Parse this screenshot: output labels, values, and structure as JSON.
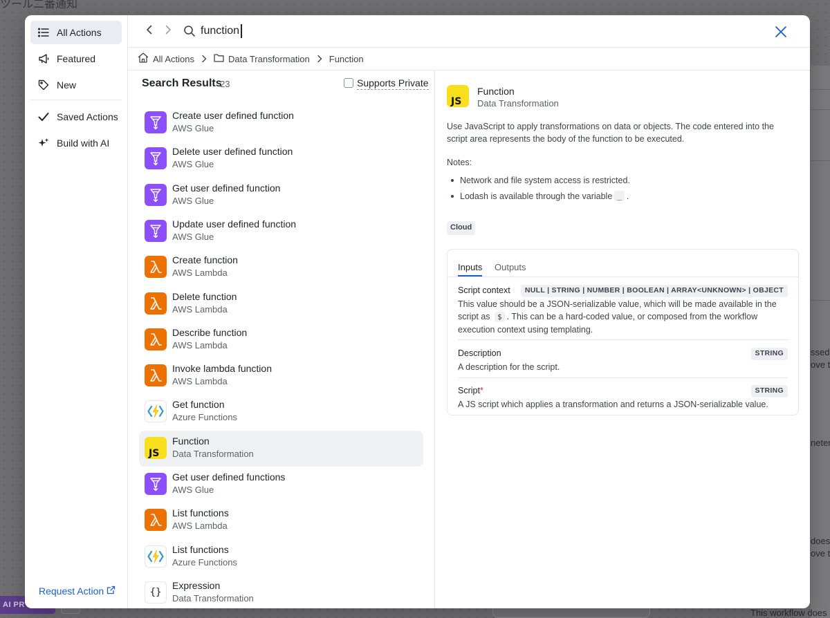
{
  "background": {
    "title_fragment": "ツール二番通知",
    "right_fragments": [
      "ssed",
      "ove to",
      "neters",
      "does",
      "ove t"
    ],
    "bottom_badge": "AI PR",
    "bottom_text": "This workflow does"
  },
  "sidebar": {
    "items": [
      {
        "label": "All Actions",
        "icon": "list-icon",
        "active": true
      },
      {
        "label": "Featured",
        "icon": "megaphone-icon",
        "active": false
      },
      {
        "label": "New",
        "icon": "tag-icon",
        "active": false
      },
      {
        "label": "Saved Actions",
        "icon": "check-icon",
        "active": false
      },
      {
        "label": "Build with AI",
        "icon": "sparkle-icon",
        "active": false
      }
    ],
    "request_action": "Request Action"
  },
  "search": {
    "value": "function"
  },
  "breadcrumb": {
    "items": [
      "All Actions",
      "Data Transformation",
      "Function"
    ]
  },
  "results": {
    "title": "Search Results",
    "count": "23",
    "supports_private_label": "Supports Private",
    "supports_private_checked": false,
    "items": [
      {
        "name": "Create user defined function",
        "app": "AWS Glue",
        "icon": "aws-glue-icon"
      },
      {
        "name": "Delete user defined function",
        "app": "AWS Glue",
        "icon": "aws-glue-icon"
      },
      {
        "name": "Get user defined function",
        "app": "AWS Glue",
        "icon": "aws-glue-icon"
      },
      {
        "name": "Update user defined function",
        "app": "AWS Glue",
        "icon": "aws-glue-icon"
      },
      {
        "name": "Create function",
        "app": "AWS Lambda",
        "icon": "aws-lambda-icon"
      },
      {
        "name": "Delete function",
        "app": "AWS Lambda",
        "icon": "aws-lambda-icon"
      },
      {
        "name": "Describe function",
        "app": "AWS Lambda",
        "icon": "aws-lambda-icon"
      },
      {
        "name": "Invoke lambda function",
        "app": "AWS Lambda",
        "icon": "aws-lambda-icon"
      },
      {
        "name": "Get function",
        "app": "Azure Functions",
        "icon": "azure-functions-icon"
      },
      {
        "name": "Function",
        "app": "Data Transformation",
        "icon": "javascript-icon",
        "selected": true
      },
      {
        "name": "Get user defined functions",
        "app": "AWS Glue",
        "icon": "aws-glue-icon"
      },
      {
        "name": "List functions",
        "app": "AWS Lambda",
        "icon": "aws-lambda-icon"
      },
      {
        "name": "List functions",
        "app": "Azure Functions",
        "icon": "azure-functions-icon"
      },
      {
        "name": "Expression",
        "app": "Data Transformation",
        "icon": "braces-icon"
      }
    ]
  },
  "details": {
    "icon_text": "JS",
    "title": "Function",
    "subtitle": "Data Transformation",
    "description": "Use JavaScript to apply transformations on data or objects. The code entered into the script area represents the body of the function to be executed.",
    "notes_label": "Notes:",
    "note_1": "Network and file system access is restricted.",
    "note_2_prefix": "Lodash is available through the variable",
    "note_2_code": "_",
    "note_2_suffix": ".",
    "badge": "Cloud",
    "tabs": [
      "Inputs",
      "Outputs"
    ],
    "inputs": [
      {
        "name": "Script context",
        "required": false,
        "type": "NULL | STRING | NUMBER | BOOLEAN | ARRAY<UNKNOWN> | OBJECT",
        "desc_prefix": "This value should be a JSON-serializable value, which will be made available in the script as",
        "desc_code": "$",
        "desc_suffix": ". This can be a hard-coded value, or composed from the workflow execution context using templating."
      },
      {
        "name": "Description",
        "required": false,
        "type": "STRING",
        "desc": "A description for the script."
      },
      {
        "name": "Script",
        "required": true,
        "type": "STRING",
        "desc": "A JS script which applies a transformation and returns a JSON-serializable value."
      }
    ]
  },
  "colors": {
    "accent": "#1d5fc6",
    "aws_glue": "#8c4fff",
    "aws_lambda": "#ed7100",
    "javascript": "#f7df1e",
    "required": "#d13438"
  }
}
